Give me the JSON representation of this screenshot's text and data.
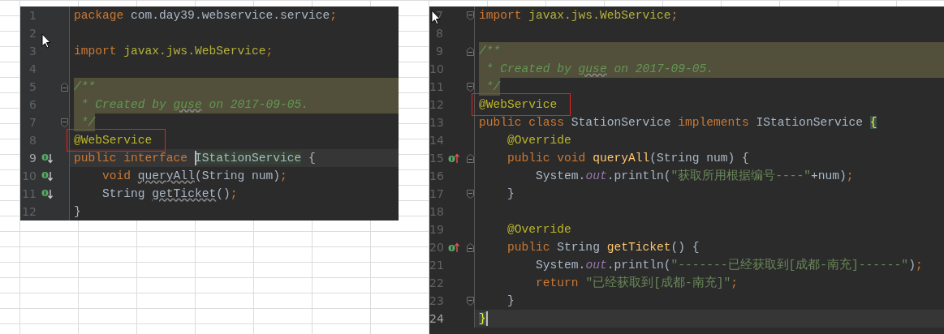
{
  "editors": [
    {
      "lines": [
        {
          "number": "1",
          "current": false,
          "tokens": [
            {
              "kind": "keyword",
              "text": "package "
            },
            {
              "kind": "plain",
              "text": "com.day39.webservice.service"
            },
            {
              "kind": "keyword",
              "text": ";"
            }
          ]
        },
        {
          "number": "2",
          "current": false
        },
        {
          "number": "3",
          "current": false,
          "tokens": [
            {
              "kind": "keyword",
              "text": "import "
            },
            {
              "kind": "import",
              "text": "javax.jws.WebService"
            },
            {
              "kind": "keyword",
              "text": ";"
            }
          ]
        },
        {
          "number": "4",
          "current": false
        },
        {
          "number": "5",
          "current": false,
          "fold": {
            "kind": "start"
          },
          "highlight": {
            "kind": "full"
          },
          "tokens": [
            {
              "kind": "doc",
              "text": "/**"
            }
          ]
        },
        {
          "number": "6",
          "current": false,
          "highlight": {
            "kind": "full"
          },
          "tokens": [
            {
              "kind": "doc",
              "text": " * Created by "
            },
            {
              "kind": "doc",
              "text": "guse",
              "underlined": true
            },
            {
              "kind": "doc",
              "text": " on 2017-09-05."
            }
          ]
        },
        {
          "number": "7",
          "current": false,
          "fold": {
            "kind": "end"
          },
          "highlight": {
            "kind": "partial"
          },
          "tokens": [
            {
              "kind": "doc",
              "text": " */"
            }
          ]
        },
        {
          "number": "8",
          "current": false,
          "tokens": [
            {
              "kind": "annotation",
              "text": "@WebService",
              "boxed": true
            }
          ]
        },
        {
          "number": "9",
          "current": true,
          "marker": {
            "kind": "implemented"
          },
          "tokens": [
            {
              "kind": "keyword",
              "text": "public interface "
            },
            {
              "kind": "plain",
              "text": "IStationService",
              "usage": true,
              "caret_before": true
            },
            {
              "kind": "plain",
              "text": " {"
            }
          ]
        },
        {
          "number": "10",
          "current": false,
          "marker": {
            "kind": "implemented"
          },
          "tokens": [
            {
              "kind": "keyword",
              "text": "    void "
            },
            {
              "kind": "plain",
              "text": "queryAll",
              "underlined": true
            },
            {
              "kind": "plain",
              "text": "(String num)"
            },
            {
              "kind": "keyword",
              "text": ";"
            }
          ]
        },
        {
          "number": "11",
          "current": false,
          "marker": {
            "kind": "implemented"
          },
          "tokens": [
            {
              "kind": "plain",
              "text": "    String "
            },
            {
              "kind": "plain",
              "text": "getTicket",
              "underlined": true
            },
            {
              "kind": "plain",
              "text": "()"
            },
            {
              "kind": "keyword",
              "text": ";"
            }
          ]
        },
        {
          "number": "12",
          "current": false,
          "tokens": [
            {
              "kind": "plain",
              "text": "}"
            }
          ]
        }
      ]
    },
    {
      "lines": [
        {
          "number": "7",
          "current": false,
          "fold": {
            "kind": "end"
          },
          "tokens": [
            {
              "kind": "keyword",
              "text": "import "
            },
            {
              "kind": "import",
              "text": "javax.jws.WebService"
            },
            {
              "kind": "keyword",
              "text": ";"
            }
          ]
        },
        {
          "number": "8",
          "current": false
        },
        {
          "number": "9",
          "current": false,
          "fold": {
            "kind": "start"
          },
          "highlight": {
            "kind": "full"
          },
          "tokens": [
            {
              "kind": "doc",
              "text": "/**"
            }
          ]
        },
        {
          "number": "10",
          "current": false,
          "highlight": {
            "kind": "full"
          },
          "tokens": [
            {
              "kind": "doc",
              "text": " * Created by "
            },
            {
              "kind": "doc",
              "text": "guse",
              "underlined": true
            },
            {
              "kind": "doc",
              "text": " on 2017-09-05."
            }
          ]
        },
        {
          "number": "11",
          "current": false,
          "fold": {
            "kind": "end"
          },
          "highlight": {
            "kind": "partial"
          },
          "tokens": [
            {
              "kind": "doc",
              "text": " */"
            }
          ]
        },
        {
          "number": "12",
          "current": false,
          "tokens": [
            {
              "kind": "annotation",
              "text": "@WebService",
              "boxed": true
            }
          ]
        },
        {
          "number": "13",
          "current": false,
          "tokens": [
            {
              "kind": "keyword",
              "text": "public class "
            },
            {
              "kind": "plain",
              "text": "StationService "
            },
            {
              "kind": "keyword",
              "text": "implements "
            },
            {
              "kind": "plain",
              "text": "IStationService "
            },
            {
              "kind": "plain",
              "text": "{",
              "matched": true
            }
          ]
        },
        {
          "number": "14",
          "current": false,
          "tokens": [
            {
              "kind": "annotation",
              "text": "    @Override"
            }
          ]
        },
        {
          "number": "15",
          "current": false,
          "marker": {
            "kind": "overrides"
          },
          "fold": {
            "kind": "start"
          },
          "tokens": [
            {
              "kind": "keyword",
              "text": "    public void "
            },
            {
              "kind": "method",
              "text": "queryAll"
            },
            {
              "kind": "plain",
              "text": "(String num) {"
            }
          ]
        },
        {
          "number": "16",
          "current": false,
          "tokens": [
            {
              "kind": "plain",
              "text": "        System."
            },
            {
              "kind": "field",
              "text": "out"
            },
            {
              "kind": "plain",
              "text": ".println("
            },
            {
              "kind": "string",
              "text": "\"获取所用根据编号----\""
            },
            {
              "kind": "plain",
              "text": "+num)"
            },
            {
              "kind": "keyword",
              "text": ";"
            }
          ]
        },
        {
          "number": "17",
          "current": false,
          "fold": {
            "kind": "end"
          },
          "tokens": [
            {
              "kind": "plain",
              "text": "    }"
            }
          ]
        },
        {
          "number": "18",
          "current": false
        },
        {
          "number": "19",
          "current": false,
          "tokens": [
            {
              "kind": "annotation",
              "text": "    @Override"
            }
          ]
        },
        {
          "number": "20",
          "current": false,
          "marker": {
            "kind": "overrides"
          },
          "fold": {
            "kind": "start"
          },
          "tokens": [
            {
              "kind": "keyword",
              "text": "    public "
            },
            {
              "kind": "plain",
              "text": "String "
            },
            {
              "kind": "method",
              "text": "getTicket"
            },
            {
              "kind": "plain",
              "text": "() {"
            }
          ]
        },
        {
          "number": "21",
          "current": false,
          "tokens": [
            {
              "kind": "plain",
              "text": "        System."
            },
            {
              "kind": "field",
              "text": "out"
            },
            {
              "kind": "plain",
              "text": ".println("
            },
            {
              "kind": "string",
              "text": "\"-------已经获取到[成都-南充]------\""
            },
            {
              "kind": "plain",
              "text": ")"
            },
            {
              "kind": "keyword",
              "text": ";"
            }
          ]
        },
        {
          "number": "22",
          "current": false,
          "tokens": [
            {
              "kind": "keyword",
              "text": "        return "
            },
            {
              "kind": "string",
              "text": "\"已经获取到[成都-南充]\""
            },
            {
              "kind": "keyword",
              "text": ";"
            }
          ]
        },
        {
          "number": "23",
          "current": false,
          "fold": {
            "kind": "end"
          },
          "tokens": [
            {
              "kind": "plain",
              "text": "    }"
            }
          ]
        },
        {
          "number": "24",
          "current": true,
          "tokens": [
            {
              "kind": "plain",
              "text": "}",
              "matched": true,
              "caret_after": true
            }
          ]
        }
      ]
    }
  ]
}
